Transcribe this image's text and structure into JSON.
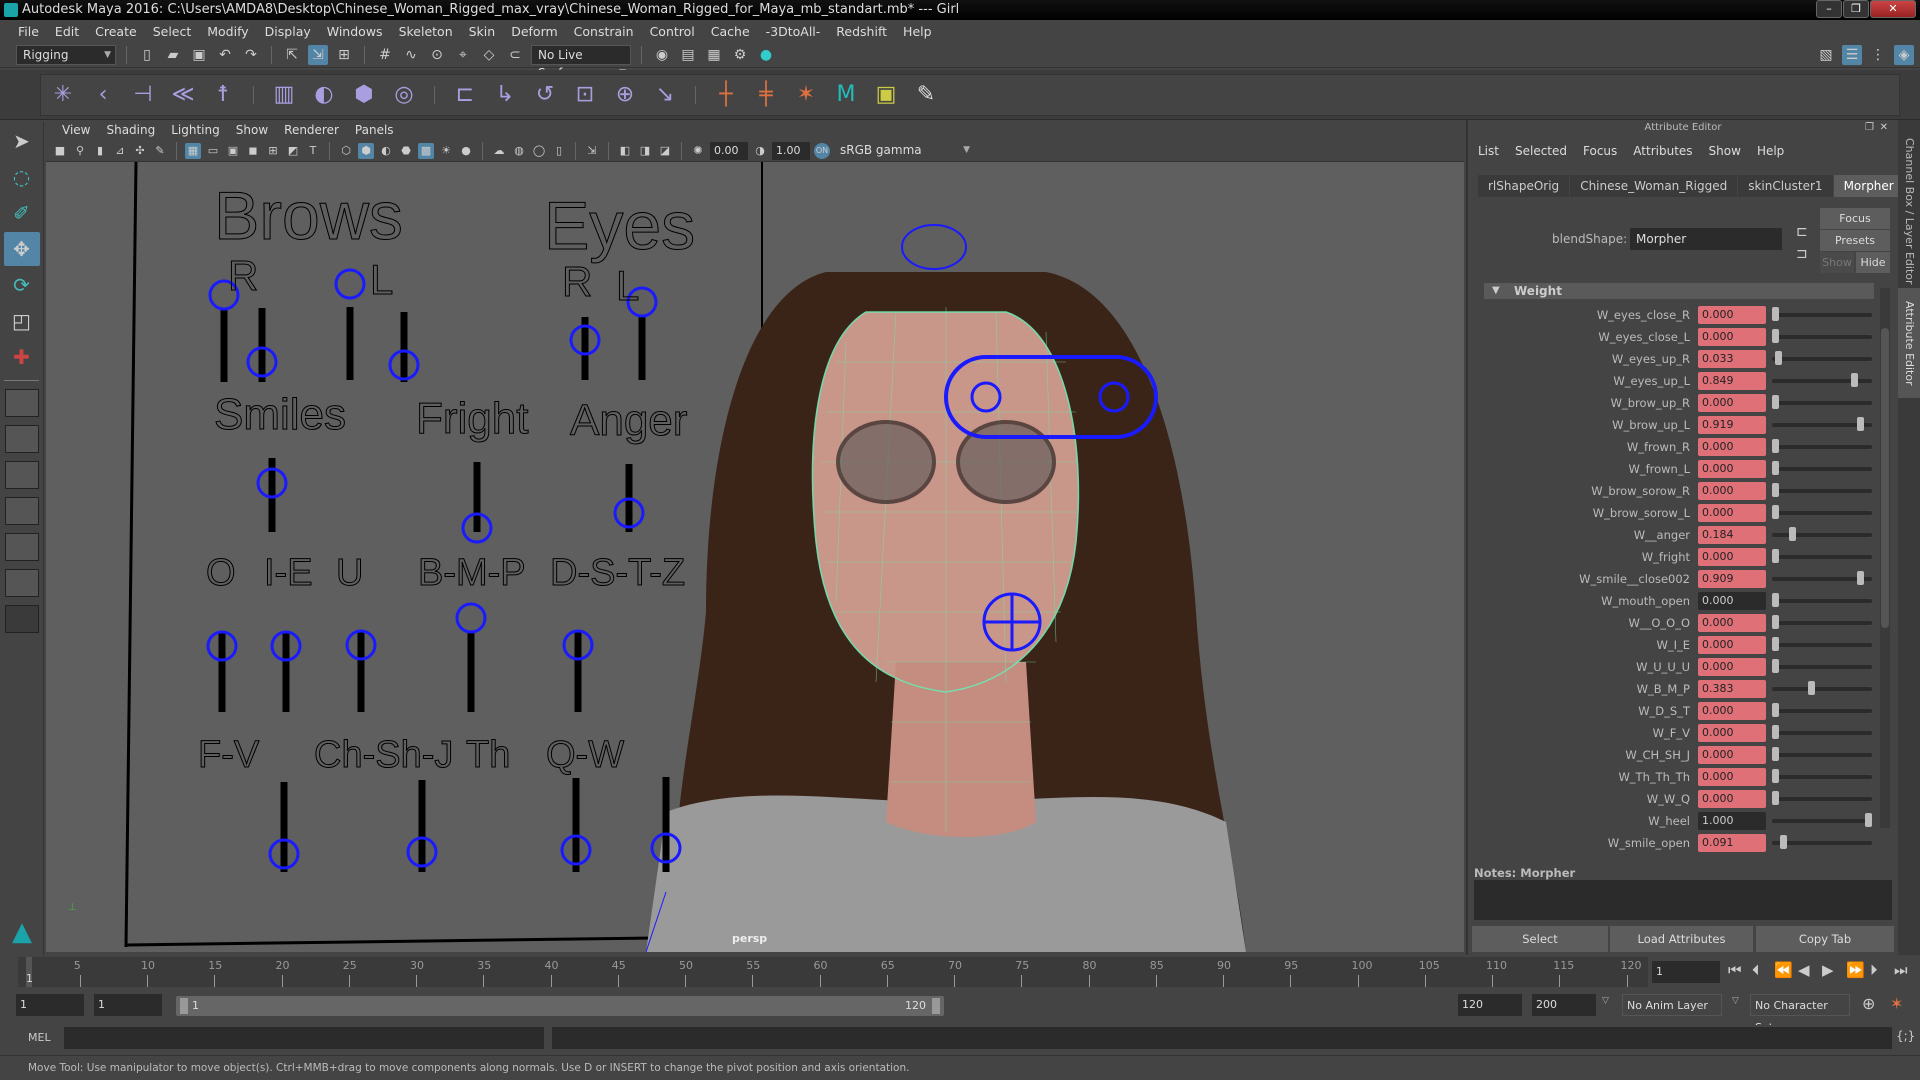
{
  "window": {
    "title": "Autodesk Maya 2016: C:\\Users\\AMDA8\\Desktop\\Chinese_Woman_Rigged_max_vray\\Chinese_Woman_Rigged_for_Maya_mb_standart.mb*  ---  Girl",
    "minimize": "–",
    "restore": "❐",
    "close": "✕"
  },
  "menubar": [
    "File",
    "Edit",
    "Create",
    "Select",
    "Modify",
    "Display",
    "Windows",
    "Skeleton",
    "Skin",
    "Deform",
    "Constrain",
    "Control",
    "Cache",
    "-3DtoAll-",
    "Redshift",
    "Help"
  ],
  "statusline": {
    "menuset": "Rigging",
    "live_surface": "No Live Surface"
  },
  "viewport": {
    "menu": [
      "View",
      "Shading",
      "Lighting",
      "Show",
      "Renderer",
      "Panels"
    ],
    "exposure": "0.00",
    "gamma": "1.00",
    "color_space": "sRGB gamma",
    "camera_label": "persp"
  },
  "rig_board": {
    "brows": "Brows",
    "eyes": "Eyes",
    "r": "R",
    "l": "L",
    "smiles": "Smiles",
    "fright": "Fright",
    "anger": "Anger",
    "o": "O",
    "ie": "I-E",
    "u": "U",
    "bmp": "B-M-P",
    "dstz": "D-S-T-Z",
    "fv": "F-V",
    "chshj": "Ch-Sh-J",
    "th": "Th",
    "qw": "Q-W"
  },
  "attribute_editor": {
    "title": "Attribute Editor",
    "menu": [
      "List",
      "Selected",
      "Focus",
      "Attributes",
      "Show",
      "Help"
    ],
    "tabs": [
      "rlShapeOrig",
      "Chinese_Woman_Rigged",
      "skinCluster1",
      "Morpher"
    ],
    "active_tab": "Morpher",
    "blendshape_label": "blendShape:",
    "blendshape_value": "Morpher",
    "focus": "Focus",
    "presets": "Presets",
    "show": "Show",
    "hide": "Hide",
    "section": "Weight",
    "weights": [
      {
        "name": "W_eyes_close_R",
        "value": "0.000",
        "keyed": true
      },
      {
        "name": "W_eyes_close_L",
        "value": "0.000",
        "keyed": true
      },
      {
        "name": "W_eyes_up_R",
        "value": "0.033",
        "keyed": true
      },
      {
        "name": "W_eyes_up_L",
        "value": "0.849",
        "keyed": true
      },
      {
        "name": "W_brow_up_R",
        "value": "0.000",
        "keyed": true
      },
      {
        "name": "W_brow_up_L",
        "value": "0.919",
        "keyed": true
      },
      {
        "name": "W_frown_R",
        "value": "0.000",
        "keyed": true
      },
      {
        "name": "W_frown_L",
        "value": "0.000",
        "keyed": true
      },
      {
        "name": "W_brow_sorow_R",
        "value": "0.000",
        "keyed": true
      },
      {
        "name": "W_brow_sorow_L",
        "value": "0.000",
        "keyed": true
      },
      {
        "name": "W__anger",
        "value": "0.184",
        "keyed": true
      },
      {
        "name": "W_fright",
        "value": "0.000",
        "keyed": true
      },
      {
        "name": "W_smile__close002",
        "value": "0.909",
        "keyed": true
      },
      {
        "name": "W_mouth_open",
        "value": "0.000",
        "keyed": false
      },
      {
        "name": "W__O_O_O",
        "value": "0.000",
        "keyed": true
      },
      {
        "name": "W_I_E",
        "value": "0.000",
        "keyed": true
      },
      {
        "name": "W_U_U_U",
        "value": "0.000",
        "keyed": true
      },
      {
        "name": "W_B_M_P",
        "value": "0.383",
        "keyed": true
      },
      {
        "name": "W_D_S_T",
        "value": "0.000",
        "keyed": true
      },
      {
        "name": "W_F_V",
        "value": "0.000",
        "keyed": true
      },
      {
        "name": "W_CH_SH_J",
        "value": "0.000",
        "keyed": true
      },
      {
        "name": "W_Th_Th_Th",
        "value": "0.000",
        "keyed": true
      },
      {
        "name": "W_W_Q",
        "value": "0.000",
        "keyed": true
      },
      {
        "name": "W_heel",
        "value": "1.000",
        "keyed": false
      },
      {
        "name": "W_smile_open",
        "value": "0.091",
        "keyed": true
      }
    ],
    "notes_label": "Notes:  Morpher",
    "select": "Select",
    "load_attributes": "Load Attributes",
    "copy_tab": "Copy Tab"
  },
  "side_tabs": {
    "channel_box": "Channel Box / Layer Editor",
    "attribute_editor": "Attribute Editor"
  },
  "timeline": {
    "ticks": [
      "5",
      "10",
      "15",
      "20",
      "25",
      "30",
      "35",
      "40",
      "45",
      "50",
      "55",
      "60",
      "65",
      "70",
      "75",
      "80",
      "85",
      "90",
      "95",
      "100",
      "105",
      "110",
      "115",
      "120"
    ],
    "current_marker": "1",
    "current_frame": "1",
    "colors": {
      "keyed": "#e07078",
      "accent": "#5285a6"
    }
  },
  "range": {
    "start": "1",
    "anim_start": "1",
    "slider_start": "1",
    "slider_end": "120",
    "anim_end": "120",
    "end": "200",
    "anim_layer": "No Anim Layer",
    "character_set": "No Character Set"
  },
  "command_line": {
    "label": "MEL"
  },
  "help_line": "Move Tool: Use manipulator to move object(s). Ctrl+MMB+drag to move components along normals. Use D or INSERT to change the pivot position and axis orientation."
}
